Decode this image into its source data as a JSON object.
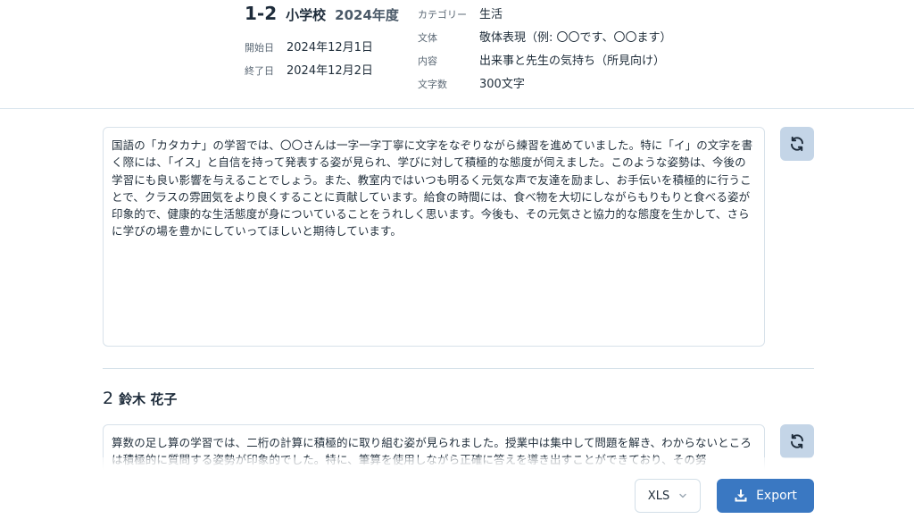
{
  "header": {
    "class_no": "1-2",
    "school": "小学校",
    "year": "2024年度",
    "start_label": "開始日",
    "start_date": "2024年12月1日",
    "end_label": "終了日",
    "end_date": "2024年12月2日",
    "meta": [
      {
        "label": "カテゴリー",
        "value": "生活"
      },
      {
        "label": "文体",
        "value": "敬体表現（例: 〇〇です、〇〇ます）"
      },
      {
        "label": "内容",
        "value": "出来事と先生の気持ち（所見向け）"
      },
      {
        "label": "文字数",
        "value": "300文字"
      }
    ]
  },
  "comments": [
    {
      "text": "国語の「カタカナ」の学習では、〇〇さんは一字一字丁寧に文字をなぞりながら練習を進めていました。特に「イ」の文字を書く際には、「イス」と自信を持って発表する姿が見られ、学びに対して積極的な態度が伺えました。このような姿勢は、今後の学習にも良い影響を与えることでしょう。また、教室内ではいつも明るく元気な声で友達を励まし、お手伝いを積極的に行うことで、クラスの雰囲気をより良くすることに貢献しています。給食の時間には、食べ物を大切にしながらもりもりと食べる姿が印象的で、健康的な生活態度が身についていることをうれしく思います。今後も、その元気さと協力的な態度を生かして、さらに学びの場を豊かにしていってほしいと期待しています。"
    },
    {
      "number": "2",
      "student_name": "鈴木 花子",
      "text": "算数の足し算の学習では、二桁の計算に積極的に取り組む姿が見られました。授業中は集中して問題を解き、わからないところは積極的に質問する姿勢が印象的でした。特に、筆算を使用しながら正確に答えを導き出すことができており、その努"
    }
  ],
  "footer": {
    "format": "XLS",
    "export_label": "Export"
  },
  "colors": {
    "accent": "#3a78c2",
    "refresh_bg": "#c4d5e7"
  },
  "icons": [
    "refresh-icon",
    "chevron-down-icon",
    "download-icon"
  ]
}
